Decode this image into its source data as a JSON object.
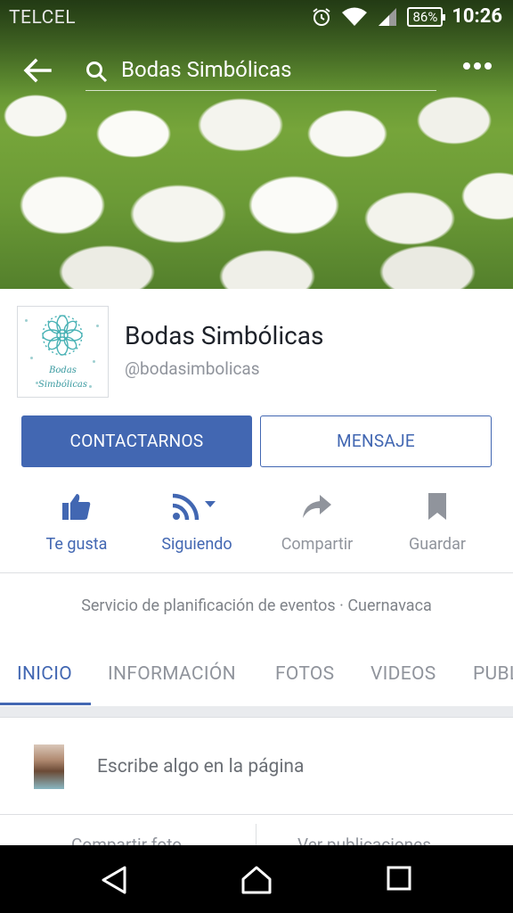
{
  "status_bar": {
    "carrier": "TELCEL",
    "battery": "86%",
    "time": "10:26"
  },
  "header": {
    "search_text": "Bodas Simbólicas"
  },
  "profile": {
    "name": "Bodas Simbólicas",
    "handle": "@bodasimbolicas",
    "logo_text_1": "Bodas",
    "logo_text_2": "Simbólicas"
  },
  "buttons": {
    "contact": "CONTACTARNOS",
    "message": "MENSAJE"
  },
  "actions": [
    {
      "label": "Te gusta",
      "icon": "thumbs-up-icon"
    },
    {
      "label": "Siguiendo",
      "icon": "rss-icon"
    },
    {
      "label": "Compartir",
      "icon": "share-icon"
    },
    {
      "label": "Guardar",
      "icon": "bookmark-icon"
    }
  ],
  "category": "Servicio de planificación de eventos · Cuernavaca",
  "tabs": [
    "INICIO",
    "INFORMACIÓN",
    "FOTOS",
    "VIDEOS",
    "PUBLICACIONES"
  ],
  "composer": {
    "placeholder": "Escribe algo en la página"
  },
  "below": {
    "left": "Compartir foto",
    "right": "Ver publicaciones"
  },
  "colors": {
    "accent": "#4267b2",
    "muted": "#90949c"
  }
}
